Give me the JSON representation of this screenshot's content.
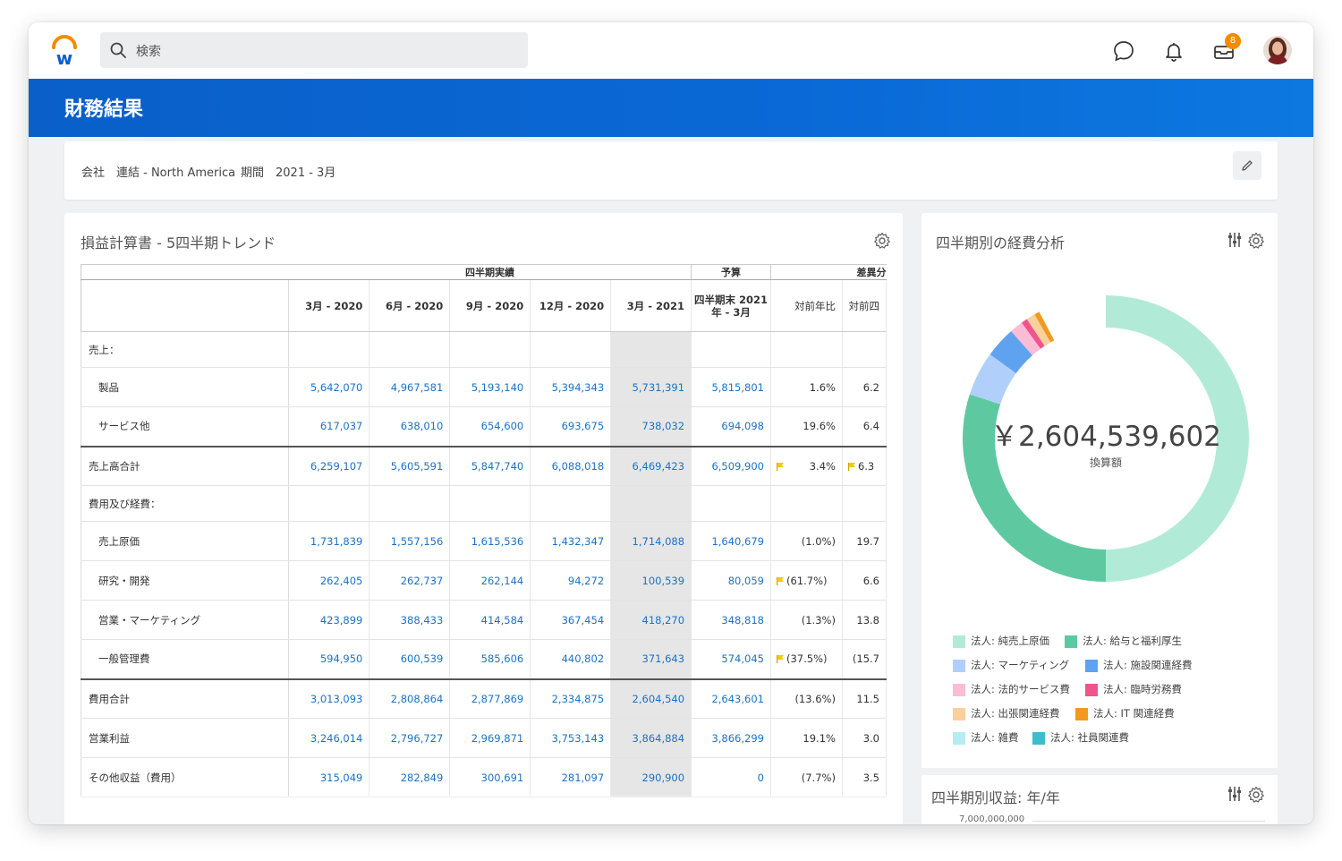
{
  "search": {
    "placeholder": "検索"
  },
  "notifications": {
    "inbox_count": "8"
  },
  "page": {
    "title": "財務結果"
  },
  "filters": {
    "company_label": "会社",
    "company_value": "連結 - North America",
    "period_label": "期間",
    "period_value": "2021 - 3月"
  },
  "income": {
    "title": "損益計算書 - 5四半期トレンド",
    "groups": {
      "actuals": "四半期実績",
      "budget": "予算",
      "variance": "差異分"
    },
    "columns": [
      "3月 - 2020",
      "6月 - 2020",
      "9月 - 2020",
      "12月 - 2020",
      "3月 - 2021",
      "四半期末 2021 年 - 3月",
      "対前年比",
      "対前四"
    ],
    "rows": [
      {
        "label": "売上：",
        "kind": "section",
        "values": [
          "",
          "",
          "",
          "",
          "",
          "",
          "",
          ""
        ]
      },
      {
        "label": "製品",
        "kind": "sub",
        "values": [
          "5,642,070",
          "4,967,581",
          "5,193,140",
          "5,394,343",
          "5,731,391",
          "5,815,801",
          "1.6%",
          "6.2"
        ]
      },
      {
        "label": "サービス他",
        "kind": "sub",
        "values": [
          "617,037",
          "638,010",
          "654,600",
          "693,675",
          "738,032",
          "694,098",
          "19.6%",
          "6.4"
        ]
      },
      {
        "label": "売上高合計",
        "kind": "total",
        "values": [
          "6,259,107",
          "5,605,591",
          "5,847,740",
          "6,088,018",
          "6,469,423",
          "6,509,900",
          "3.4%",
          "6.3"
        ],
        "flags": [
          true,
          true
        ]
      },
      {
        "label": "費用及び経費：",
        "kind": "section",
        "values": [
          "",
          "",
          "",
          "",
          "",
          "",
          "",
          ""
        ]
      },
      {
        "label": "売上原価",
        "kind": "sub",
        "values": [
          "1,731,839",
          "1,557,156",
          "1,615,536",
          "1,432,347",
          "1,714,088",
          "1,640,679",
          "(1.0%)",
          "19.7"
        ]
      },
      {
        "label": "研究・開発",
        "kind": "sub",
        "values": [
          "262,405",
          "262,737",
          "262,144",
          "94,272",
          "100,539",
          "80,059",
          "(61.7%)",
          "6.6"
        ],
        "flags": [
          true,
          false
        ]
      },
      {
        "label": "営業・マーケティング",
        "kind": "sub",
        "values": [
          "423,899",
          "388,433",
          "414,584",
          "367,454",
          "418,270",
          "348,818",
          "(1.3%)",
          "13.8"
        ]
      },
      {
        "label": "一般管理費",
        "kind": "sub",
        "values": [
          "594,950",
          "600,539",
          "585,606",
          "440,802",
          "371,643",
          "574,045",
          "(37.5%)",
          "(15.7"
        ],
        "flags": [
          true,
          false
        ]
      },
      {
        "label": "費用合計",
        "kind": "total",
        "values": [
          "3,013,093",
          "2,808,864",
          "2,877,869",
          "2,334,875",
          "2,604,540",
          "2,643,601",
          "(13.6%)",
          "11.5"
        ]
      },
      {
        "label": "営業利益",
        "kind": "main",
        "values": [
          "3,246,014",
          "2,796,727",
          "2,969,871",
          "3,753,143",
          "3,864,884",
          "3,866,299",
          "19.1%",
          "3.0"
        ]
      },
      {
        "label": "その他収益（費用）",
        "kind": "main",
        "values": [
          "315,049",
          "282,849",
          "300,691",
          "281,097",
          "290,900",
          "0",
          "(7.7%)",
          "3.5"
        ]
      }
    ]
  },
  "expense": {
    "title": "四半期別の経費分析",
    "total": "￥2,604,539,602",
    "total_caption": "換算額",
    "segments": [
      {
        "name": "法人: 純売上原価",
        "share": 0.5,
        "color": "#b2ead8"
      },
      {
        "name": "法人: 給与と福利厚生",
        "share": 0.3,
        "color": "#5ec9a1"
      },
      {
        "name": "法人: マーケティング",
        "share": 0.05,
        "color": "#b0d0fb"
      },
      {
        "name": "法人: 施設関連経費",
        "share": 0.035,
        "color": "#5fa3f0"
      },
      {
        "name": "法人: 法的サービス費",
        "share": 0.015,
        "color": "#fbbcd6"
      },
      {
        "name": "法人: 臨時労務費",
        "share": 0.007,
        "color": "#f0548c"
      },
      {
        "name": "法人: 出張関連経費",
        "share": 0.01,
        "color": "#fad09e"
      },
      {
        "name": "法人: IT 関連経費",
        "share": 0.006,
        "color": "#f29a1f"
      },
      {
        "name": "法人: 雑費",
        "share": 0.0,
        "color": "#b4ecf2"
      },
      {
        "name": "法人: 社員関連費",
        "share": 0.0,
        "color": "#3fbccb"
      }
    ]
  },
  "revenue": {
    "title": "四半期別収益: 年/年",
    "axis_top": "7,000,000,000"
  }
}
